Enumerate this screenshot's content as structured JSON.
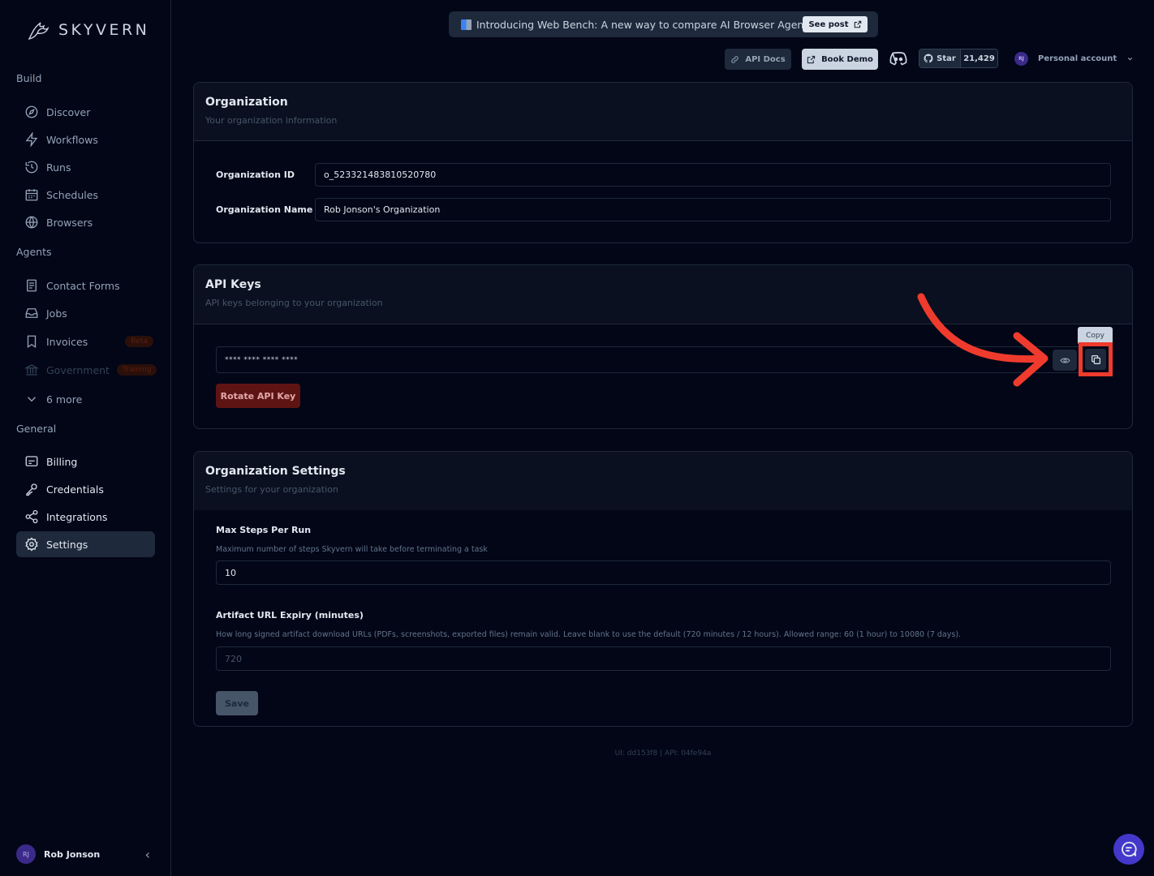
{
  "brand": {
    "name": "SKYVERN"
  },
  "sidebar": {
    "sections": {
      "build": "Build",
      "agents": "Agents",
      "general": "General"
    },
    "build_items": {
      "discover": "Discover",
      "workflows": "Workflows",
      "runs": "Runs",
      "schedules": "Schedules",
      "browsers": "Browsers"
    },
    "agent_items": {
      "contact_forms": "Contact Forms",
      "jobs": "Jobs",
      "invoices": "Invoices",
      "invoices_badge": "Beta",
      "government": "Government",
      "government_badge": "Training",
      "more": "6 more"
    },
    "general_items": {
      "billing": "Billing",
      "credentials": "Credentials",
      "integrations": "Integrations",
      "settings": "Settings"
    },
    "user": {
      "initials": "RJ",
      "name": "Rob Jonson"
    }
  },
  "header": {
    "banner_text": "Introducing Web Bench: A new way to compare AI Browser Agents",
    "banner_button": "See post",
    "api_docs": "API Docs",
    "book_demo": "Book Demo",
    "github_star": "Star",
    "github_count": "21,429",
    "account_initials": "RJ",
    "account_label": "Personal account"
  },
  "organization": {
    "title": "Organization",
    "subtitle": "Your organization information",
    "id_label": "Organization ID",
    "id_value": "o_523321483810520780",
    "name_label": "Organization Name",
    "name_value": "Rob Jonson's Organization"
  },
  "api_keys": {
    "title": "API Keys",
    "subtitle": "API keys belonging to your organization",
    "masked_key": "**** **** **** ****",
    "copy_tooltip": "Copy",
    "rotate_button": "Rotate API Key"
  },
  "org_settings": {
    "title": "Organization Settings",
    "subtitle": "Settings for your organization",
    "max_steps_label": "Max Steps Per Run",
    "max_steps_help": "Maximum number of steps Skyvern will take before terminating a task",
    "max_steps_value": "10",
    "expiry_label": "Artifact URL Expiry (minutes)",
    "expiry_help": "How long signed artifact download URLs (PDFs, screenshots, exported files) remain valid. Leave blank to use the default (720 minutes / 12 hours). Allowed range: 60 (1 hour) to 10080 (7 days).",
    "expiry_placeholder": "720",
    "save_button": "Save"
  },
  "footer": {
    "version": "UI: dd153f8 | API: 04fe94a"
  },
  "colors": {
    "annotation_red": "#ef3b2d",
    "background": "#020617",
    "accent_purple": "#4338ca"
  }
}
